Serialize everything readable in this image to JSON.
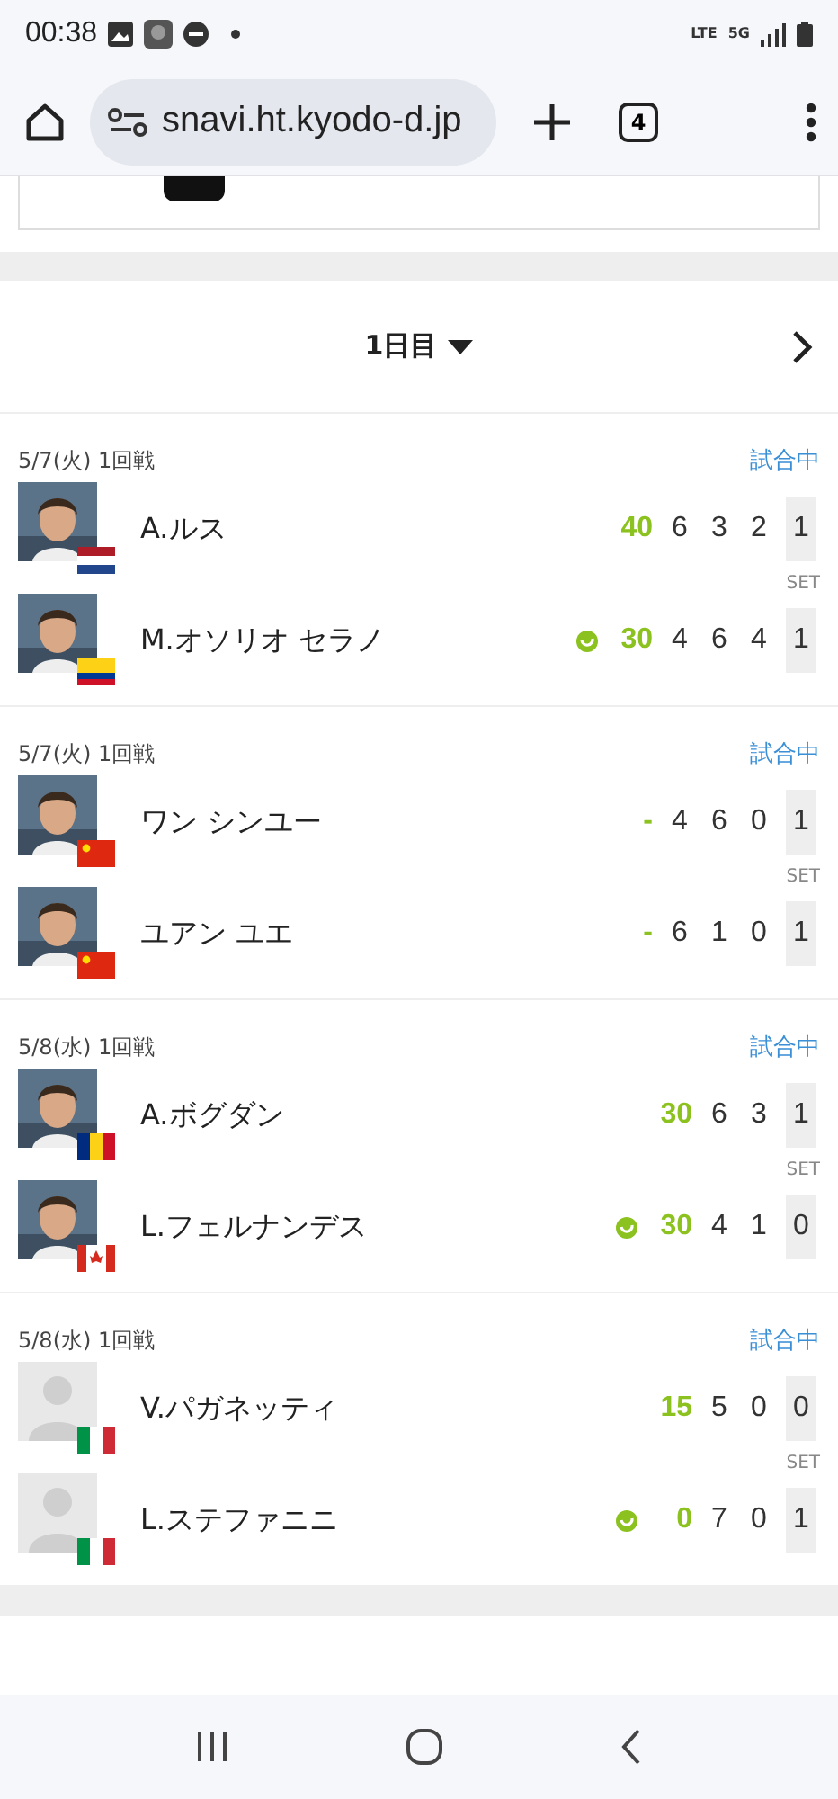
{
  "status_bar": {
    "time": "00:38",
    "network": [
      "LTE",
      "5G"
    ]
  },
  "browser": {
    "url": "snavi.ht.kyodo-d.jp",
    "tab_count": "4"
  },
  "day_selector": {
    "label": "1日目"
  },
  "matches": [
    {
      "date": "5/7(火) 1回戦",
      "status": "試合中",
      "set_label": "SET",
      "players": [
        {
          "name": "A.ルス",
          "flag": {
            "kind": "netherlands"
          },
          "avatar": {
            "kind": "picture"
          },
          "serving": false,
          "point": "40",
          "sets": [
            "6",
            "3",
            "2"
          ],
          "set_count": "1"
        },
        {
          "name": "M.オソリオ セラノ",
          "flag": {
            "kind": "colombia"
          },
          "avatar": {
            "kind": "picture"
          },
          "serving": true,
          "point": "30",
          "sets": [
            "4",
            "6",
            "4"
          ],
          "set_count": "1"
        }
      ]
    },
    {
      "date": "5/7(火) 1回戦",
      "status": "試合中",
      "set_label": "SET",
      "players": [
        {
          "name": "ワン シンユー",
          "flag": {
            "kind": "china"
          },
          "avatar": {
            "kind": "picture"
          },
          "serving": false,
          "point": "-",
          "sets": [
            "4",
            "6",
            "0"
          ],
          "set_count": "1"
        },
        {
          "name": "ユアン ユエ",
          "flag": {
            "kind": "china"
          },
          "avatar": {
            "kind": "picture"
          },
          "serving": false,
          "point": "-",
          "sets": [
            "6",
            "1",
            "0"
          ],
          "set_count": "1"
        }
      ]
    },
    {
      "date": "5/8(水) 1回戦",
      "status": "試合中",
      "set_label": "SET",
      "players": [
        {
          "name": "A.ボグダン",
          "flag": {
            "kind": "romania"
          },
          "avatar": {
            "kind": "picture"
          },
          "serving": false,
          "point": "30",
          "sets": [
            "6",
            "3"
          ],
          "set_count": "1"
        },
        {
          "name": "L.フェルナンデス",
          "flag": {
            "kind": "canada"
          },
          "avatar": {
            "kind": "picture"
          },
          "serving": true,
          "point": "30",
          "sets": [
            "4",
            "1"
          ],
          "set_count": "0"
        }
      ]
    },
    {
      "date": "5/8(水) 1回戦",
      "status": "試合中",
      "set_label": "SET",
      "players": [
        {
          "name": "V.パガネッティ",
          "flag": {
            "kind": "italy"
          },
          "avatar": {
            "kind": "placeholder"
          },
          "serving": false,
          "point": "15",
          "sets": [
            "5",
            "0"
          ],
          "set_count": "0"
        },
        {
          "name": "L.ステファニニ",
          "flag": {
            "kind": "italy"
          },
          "avatar": {
            "kind": "placeholder"
          },
          "serving": true,
          "point": "0",
          "sets": [
            "7",
            "0"
          ],
          "set_count": "1"
        }
      ]
    }
  ]
}
